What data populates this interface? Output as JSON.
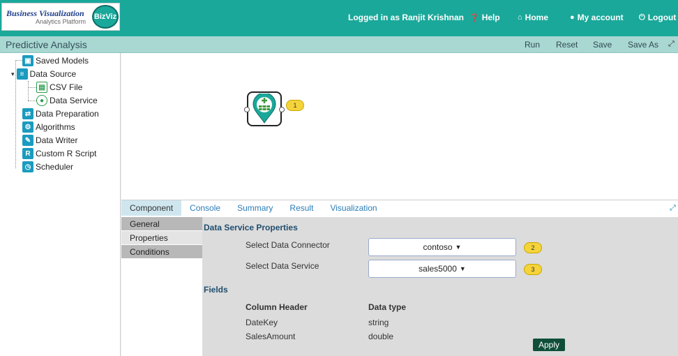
{
  "header": {
    "logo_title": "Business Visualization",
    "logo_subtitle": "Analytics Platform",
    "logo_badge": "BizViz",
    "user_status": "Logged in as Ranjit Krishnan",
    "help": "Help",
    "home": "Home",
    "account": "My account",
    "logout": "Logout"
  },
  "titlebar": {
    "title": "Predictive Analysis",
    "run": "Run",
    "reset": "Reset",
    "save": "Save",
    "save_as": "Save As"
  },
  "sidebar": {
    "items": [
      {
        "label": "Saved Models",
        "icon": "saved-models-icon"
      },
      {
        "label": "Data Source",
        "icon": "database-icon"
      },
      {
        "label": "CSV File",
        "icon": "csv-file-icon"
      },
      {
        "label": "Data Service",
        "icon": "data-service-icon"
      },
      {
        "label": "Data Preparation",
        "icon": "data-preparation-icon"
      },
      {
        "label": "Algorithms",
        "icon": "algorithms-icon"
      },
      {
        "label": "Data Writer",
        "icon": "data-writer-icon"
      },
      {
        "label": "Custom R Script",
        "icon": "r-script-icon"
      },
      {
        "label": "Scheduler",
        "icon": "scheduler-icon"
      }
    ]
  },
  "canvas": {
    "callout_1": "1"
  },
  "tabs": [
    "Component",
    "Console",
    "Summary",
    "Result",
    "Visualization"
  ],
  "subnav": [
    "General",
    "Properties",
    "Conditions"
  ],
  "properties": {
    "section_title": "Data Service Properties",
    "connector_label": "Select Data Connector",
    "connector_value": "contoso",
    "service_label": "Select Data Service",
    "service_value": "sales5000",
    "callout_2": "2",
    "callout_3": "3",
    "fields_title": "Fields",
    "columns": {
      "header": "Column Header",
      "type": "Data type"
    },
    "rows": [
      {
        "name": "DateKey",
        "type": "string"
      },
      {
        "name": "SalesAmount",
        "type": "double"
      }
    ],
    "apply": "Apply"
  },
  "colors": {
    "header": "#1aa89a",
    "titlebar": "#a9d7d2",
    "callout": "#f5d33a",
    "apply": "#0f4f3a"
  }
}
